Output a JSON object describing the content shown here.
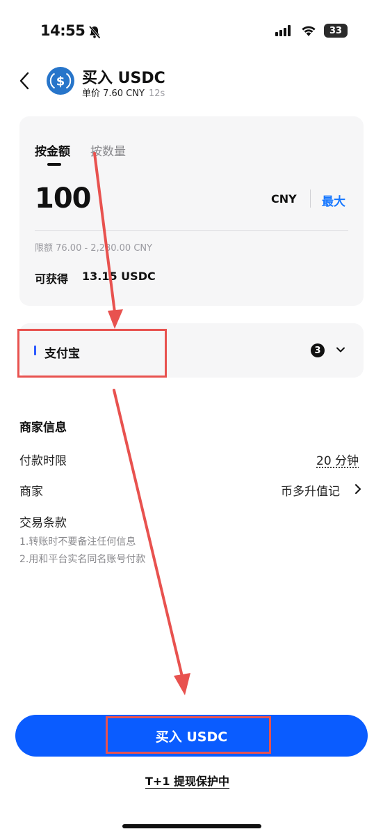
{
  "status_bar": {
    "time": "14:55",
    "battery": "33"
  },
  "header": {
    "title": "买入 USDC",
    "unit_price": "单价 7.60 CNY",
    "refresh_seconds": "12s"
  },
  "order_card": {
    "tabs": [
      {
        "label": "按金额",
        "active": true
      },
      {
        "label": "按数量",
        "active": false
      }
    ],
    "amount": "100",
    "currency": "CNY",
    "max_label": "最大",
    "limit_text": "限额 76.00 - 2,280.00 CNY",
    "receive_label": "可获得",
    "receive_value": "13.15 USDC"
  },
  "payment": {
    "method": "支付宝",
    "count": "3"
  },
  "merchant_info": {
    "section_title": "商家信息",
    "deadline_label": "付款时限",
    "deadline_value": "20 分钟",
    "merchant_label": "商家",
    "merchant_name": "币多升值记",
    "terms_label": "交易条款",
    "terms": [
      "1.转账时不要备注任何信息",
      "2.用和平台实名同名账号付款"
    ]
  },
  "actions": {
    "buy_label": "买入 USDC",
    "protection_label": "T+1 提现保护中"
  },
  "colors": {
    "accent": "#0a5cff",
    "link": "#1677ff",
    "annotation": "#e8524f"
  }
}
